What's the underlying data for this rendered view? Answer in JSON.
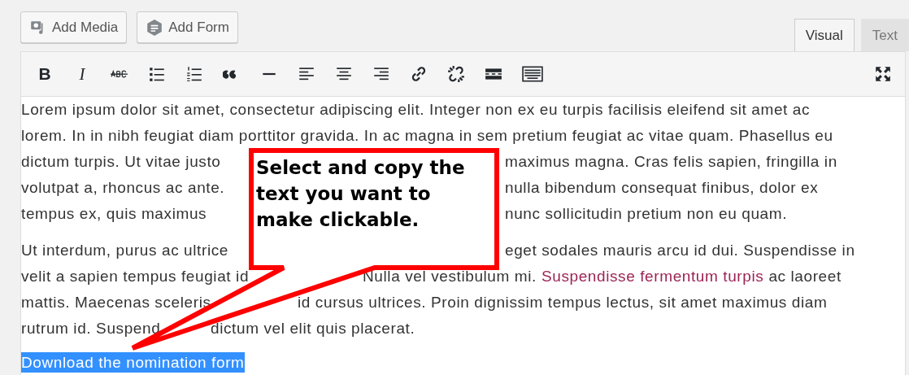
{
  "media_buttons": [
    {
      "kind": "media",
      "label": "Add Media"
    },
    {
      "kind": "form",
      "label": "Add Form"
    }
  ],
  "tabs": [
    {
      "label": "Visual",
      "selected": true
    },
    {
      "label": "Text",
      "selected": false
    }
  ],
  "toolbar": [
    {
      "kind": "bold",
      "glyph": "B"
    },
    {
      "kind": "italic",
      "glyph": "I"
    },
    {
      "kind": "strikethrough"
    },
    {
      "kind": "bullet-list"
    },
    {
      "kind": "numbered-list"
    },
    {
      "kind": "blockquote"
    },
    {
      "kind": "horizontal-line"
    },
    {
      "kind": "align-left"
    },
    {
      "kind": "align-center"
    },
    {
      "kind": "align-right"
    },
    {
      "kind": "link"
    },
    {
      "kind": "unlink"
    },
    {
      "kind": "read-more"
    },
    {
      "kind": "toolbar-toggle"
    },
    {
      "kind": "fullscreen"
    }
  ],
  "paragraphs": [
    {
      "lines": [
        {
          "left": "Lorem ipsum dolor sit amet, consectetur adipiscing elit. Integer non ex eu turpis facilisis eleifend sit amet ac"
        },
        {
          "left": "lorem. In in nibh feugiat diam porttitor gravida. In ac magna in sem pretium feugiat ac vitae quam. Phasellus eu"
        },
        {
          "left": "dictum turpis. Ut vitae justo",
          "right": "maximus magna. Cras felis sapien, fringilla in"
        },
        {
          "left": "volutpat a, rhoncus ac ante.",
          "right": "nulla bibendum consequat finibus, dolor ex"
        },
        {
          "left": "tempus ex, quis maximus",
          "right": "nunc sollicitudin pretium non eu quam."
        }
      ]
    },
    {
      "lines": [
        {
          "left": "Ut interdum, purus ac ultrice",
          "right": "eget sodales mauris arcu id dui. Suspendisse in"
        },
        {
          "left": "velit a sapien tempus feugiat id",
          "right": "Nulla vel vestibulum mi.",
          "link": "Suspendisse fermentum turpis",
          "after": "ac laoreet"
        },
        {
          "left": "mattis. Maecenas sceleris",
          "right": "id cursus ultrices. Proin dignissim tempus lectus, sit amet maximus diam"
        },
        {
          "left": "rutrum id. Suspend",
          "right": "dictum vel elit quis placerat."
        }
      ]
    }
  ],
  "selected_text": {
    "text": "Download the nomination form",
    "selected": true
  },
  "callout": {
    "text": "Select and copy the text you want to make clickable."
  }
}
